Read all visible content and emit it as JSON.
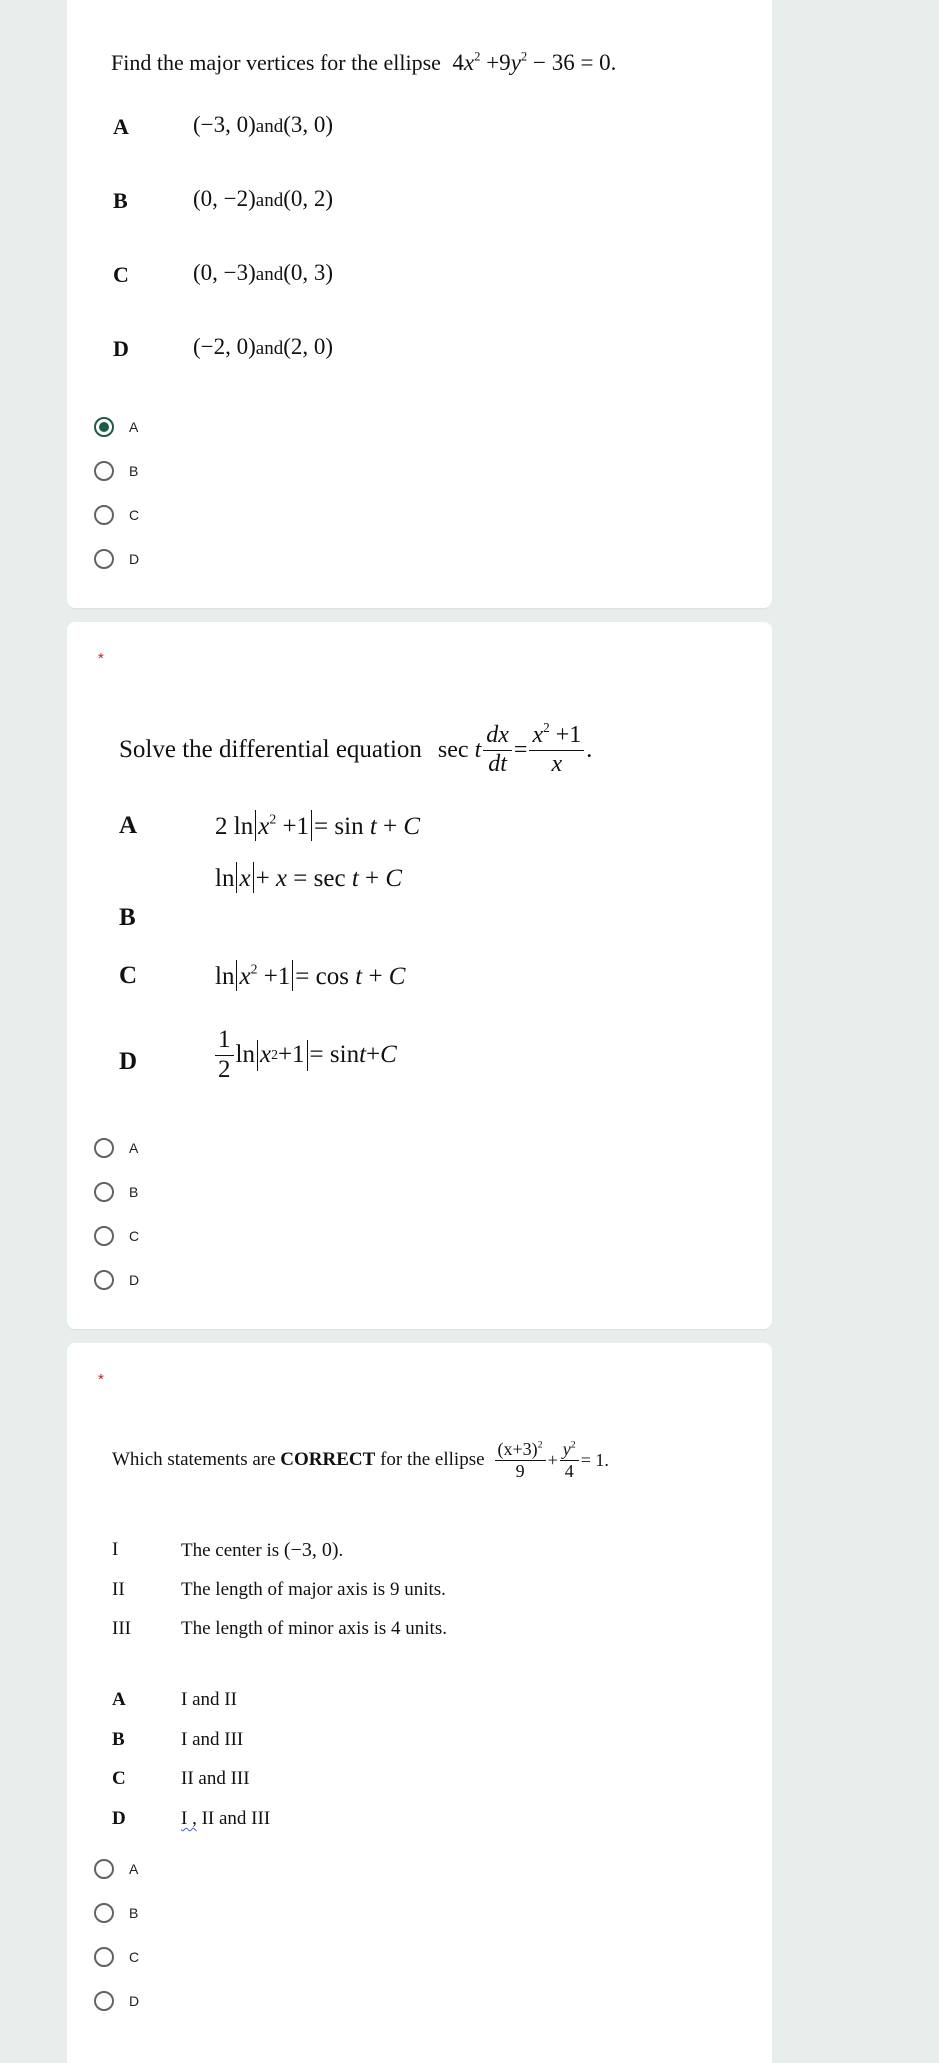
{
  "theme": {
    "accent": "#1e5c46",
    "background": "#e8eeec",
    "required": "#c5221f"
  },
  "questions": [
    {
      "required_marker": "",
      "prompt": "Find the major vertices for the ellipse",
      "equation": {
        "a": "4",
        "x": "x",
        "exp": "2",
        "b": "+9",
        "y": "y",
        "c": "− 36 = 0."
      },
      "options": [
        {
          "letter": "A",
          "p1": "(−3, 0)",
          "and": "and",
          "p2": "(3, 0)"
        },
        {
          "letter": "B",
          "p1": "(0, −2)",
          "and": "and",
          "p2": "(0, 2)"
        },
        {
          "letter": "C",
          "p1": "(0, −3)",
          "and": "and",
          "p2": "(0, 3)"
        },
        {
          "letter": "D",
          "p1": "(−2, 0)",
          "and": "and",
          "p2": "(2, 0)"
        }
      ],
      "choices": [
        "A",
        "B",
        "C",
        "D"
      ],
      "selected": "A"
    },
    {
      "required_marker": "*",
      "prompt": "Solve the differential equation",
      "equation": {
        "sec": "sec",
        "t": "t",
        "dx": "dx",
        "dt": "dt",
        "num_x": "x",
        "exp": "2",
        "num_rest": "+1",
        "den": "x",
        "eq": "=",
        "end": "."
      },
      "options": [
        {
          "letter": "A",
          "text": "2 ln|x² + 1| = sin t + C"
        },
        {
          "letter": "B",
          "text": "ln|x| + x = sec t + C"
        },
        {
          "letter": "C",
          "text": "ln|x² + 1| = cos t + C"
        },
        {
          "letter": "D",
          "text": "½ ln|x² + 1| = sin t + C"
        }
      ],
      "choices": [
        "A",
        "B",
        "C",
        "D"
      ],
      "selected": null
    },
    {
      "required_marker": "*",
      "prompt_before": "Which statements are",
      "prompt_bold": "CORRECT",
      "prompt_after": "for the ellipse",
      "equation": {
        "num1": "(x+3)",
        "exp": "2",
        "den1": "9",
        "plus": "+",
        "num2": "y",
        "den2": "4",
        "end": "= 1."
      },
      "statements": [
        {
          "numeral": "I",
          "text": "The center is",
          "math": "(−3, 0)",
          "end": "."
        },
        {
          "numeral": "II",
          "text": "The length of major axis is 9 units."
        },
        {
          "numeral": "III",
          "text": "The length of minor axis is 4 units."
        }
      ],
      "options": [
        {
          "letter": "A",
          "text": "I and II"
        },
        {
          "letter": "B",
          "text": "I and III"
        },
        {
          "letter": "C",
          "text": "II and III"
        },
        {
          "letter": "D",
          "text_first": "I ,",
          "text": " II and III"
        }
      ],
      "choices": [
        "A",
        "B",
        "C",
        "D"
      ],
      "selected": null
    }
  ]
}
